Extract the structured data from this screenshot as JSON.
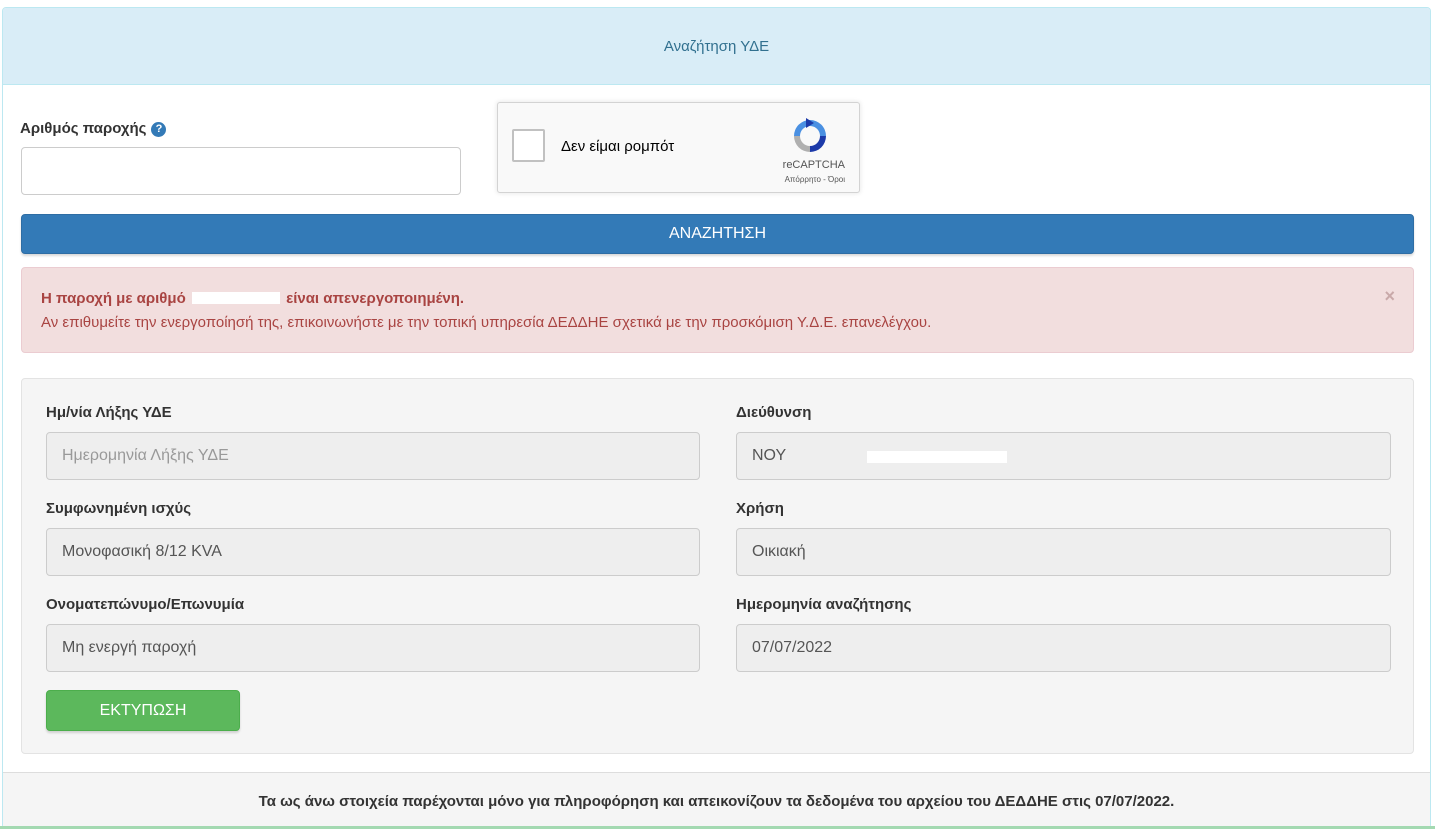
{
  "header": {
    "title": "Αναζήτηση ΥΔΕ"
  },
  "supply": {
    "label": "Αριθμός παροχής",
    "help_icon": "?",
    "value": ""
  },
  "recaptcha": {
    "label": "Δεν είμαι ρομπότ",
    "brand": "reCAPTCHA",
    "links": "Απόρρητο - Όροι"
  },
  "search_button": "ΑΝΑΖΗΤΗΣΗ",
  "alert": {
    "prefix": "Η παροχή με αριθμό",
    "suffix": "είναι απενεργοποιημένη.",
    "message": "Αν επιθυμείτε την ενεργοποίησή της, επικοινωνήστε με την τοπική υπηρεσία ΔΕΔΔΗΕ σχετικά με την προσκόμιση Υ.Δ.Ε. επανελέγχου.",
    "close": "×"
  },
  "fields": {
    "expiry": {
      "label": "Ημ/νία Λήξης ΥΔΕ",
      "placeholder": "Ημερομηνία Λήξης ΥΔΕ"
    },
    "address": {
      "label": "Διεύθυνση",
      "value": "ΝΟΥ"
    },
    "power": {
      "label": "Συμφωνημένη ισχύς",
      "value": "Μονοφασική 8/12 KVA"
    },
    "usage": {
      "label": "Χρήση",
      "value": "Οικιακή"
    },
    "name": {
      "label": "Ονοματεπώνυμο/Επωνυμία",
      "value": "Μη ενεργή παροχή"
    },
    "search_date": {
      "label": "Ημερομηνία αναζήτησης",
      "value": "07/07/2022"
    }
  },
  "print_button": "ΕΚΤΥΠΩΣΗ",
  "footer": "Τα ως άνω στοιχεία παρέχονται μόνο για πληροφόρηση και απεικονίζουν τα δεδομένα του αρχείου του ΔΕΔΔΗΕ στις 07/07/2022.",
  "colors": {
    "heading_bg": "#d9edf7",
    "primary": "#337ab7",
    "danger_bg": "#f2dede",
    "danger_text": "#a94442",
    "success": "#5cb85c"
  }
}
